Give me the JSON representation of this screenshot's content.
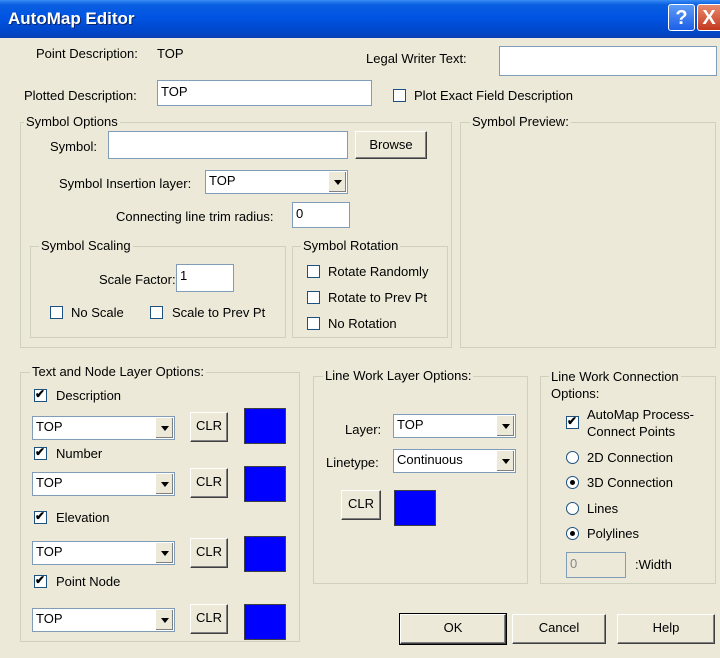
{
  "window": {
    "title": "AutoMap Editor",
    "help_icon": "?",
    "close_icon": "X"
  },
  "point_description": {
    "label": "Point Description:",
    "value": "TOP"
  },
  "legal_writer": {
    "label": "Legal Writer Text:",
    "value": ""
  },
  "plotted_description": {
    "label": "Plotted Description:",
    "value": "TOP"
  },
  "plot_exact": {
    "label": "Plot Exact Field Description",
    "checked": false
  },
  "symbol_options": {
    "title": "Symbol Options",
    "symbol_label": "Symbol:",
    "symbol_value": "",
    "browse": "Browse",
    "insertion_label": "Symbol Insertion layer:",
    "insertion_value": "TOP",
    "trim_label": "Connecting line trim radius:",
    "trim_value": "0"
  },
  "symbol_scaling": {
    "title": "Symbol Scaling",
    "factor_label": "Scale Factor:",
    "factor_value": "1",
    "no_scale": "No Scale",
    "scale_prev": "Scale to Prev Pt"
  },
  "symbol_rotation": {
    "title": "Symbol Rotation",
    "random": "Rotate Randomly",
    "prev": "Rotate to Prev Pt",
    "none": "No Rotation"
  },
  "symbol_preview": {
    "title": "Symbol Preview:"
  },
  "text_node": {
    "title": "Text and Node Layer Options:",
    "rows": [
      {
        "label": "Description",
        "checked": true,
        "layer": "TOP",
        "clr": "CLR",
        "color": "#0000ff"
      },
      {
        "label": "Number",
        "checked": true,
        "layer": "TOP",
        "clr": "CLR",
        "color": "#0000ff"
      },
      {
        "label": "Elevation",
        "checked": true,
        "layer": "TOP",
        "clr": "CLR",
        "color": "#0000ff"
      },
      {
        "label": "Point Node",
        "checked": true,
        "layer": "TOP",
        "clr": "CLR",
        "color": "#0000ff"
      }
    ]
  },
  "line_work": {
    "title": "Line Work Layer Options:",
    "layer_label": "Layer:",
    "layer_value": "TOP",
    "linetype_label": "Linetype:",
    "linetype_value": "Continuous",
    "clr": "CLR",
    "color": "#0000ff"
  },
  "connection": {
    "title_line1": "Line Work Connection",
    "title_line2": "Options:",
    "automap_line1": "AutoMap Process-",
    "automap_line2": "Connect Points",
    "conn2d": "2D Connection",
    "conn3d": "3D Connection",
    "lines": "Lines",
    "polylines": "Polylines",
    "width_value": "0",
    "width_label": ":Width"
  },
  "buttons": {
    "ok": "OK",
    "cancel": "Cancel",
    "help": "Help"
  }
}
